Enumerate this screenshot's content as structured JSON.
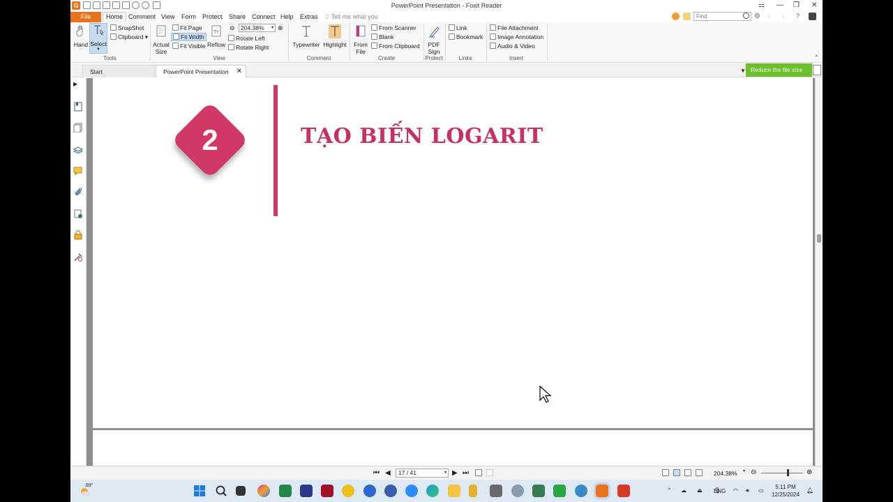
{
  "window": {
    "title": "PowerPoint Presentation - Foxit Reader",
    "app_logo": "G",
    "accent": "#e8731c"
  },
  "menu": {
    "file": "File",
    "items": [
      "Home",
      "Comment",
      "View",
      "Form",
      "Protect",
      "Share",
      "Connect",
      "Help",
      "Extras"
    ],
    "tell_me": "Tell me what you",
    "find_placeholder": "Find"
  },
  "ribbon": {
    "tools": {
      "hand": "Hand",
      "select": "Select",
      "snapshot": "SnapShot",
      "clipboard": "Clipboard",
      "label": "Tools"
    },
    "view": {
      "actual_size": "Actual Size",
      "fit_page": "Fit Page",
      "fit_width": "Fit Width",
      "fit_visible": "Fit Visible",
      "reflow": "Reflow",
      "zoom_value": "204.38%",
      "rotate_left": "Rotate Left",
      "rotate_right": "Rotate Right",
      "label": "View"
    },
    "comment": {
      "typewriter": "Typewriter",
      "highlight": "Highlight",
      "label": "Comment"
    },
    "create": {
      "from_file": "From File",
      "from_scanner": "From Scanner",
      "blank": "Blank",
      "from_clipboard": "From Clipboard",
      "label": "Create"
    },
    "protect": {
      "pdf_sign": "PDF Sign",
      "label": "Protect"
    },
    "links": {
      "link": "Link",
      "bookmark": "Bookmark",
      "label": "Links"
    },
    "insert": {
      "file_attachment": "File Attachment",
      "image_annotation": "Image Annotation",
      "audio_video": "Audio & Video",
      "label": "Insert"
    }
  },
  "tabs": {
    "start": "Start",
    "document": "PowerPoint Presentation",
    "close_glyph": "✕",
    "reduce_banner": "Reduce the file size",
    "banner_color": "#6cc02a"
  },
  "slide": {
    "number": "2",
    "title": "TẠO BIẾN LOGARIT",
    "accent": "#d23866"
  },
  "statusbar": {
    "page_indicator": "17 / 41",
    "zoom": "204.38%"
  },
  "taskbar": {
    "weather_temp": "89°",
    "language": "ENG",
    "time": "5:11 PM",
    "date": "12/25/2024"
  }
}
